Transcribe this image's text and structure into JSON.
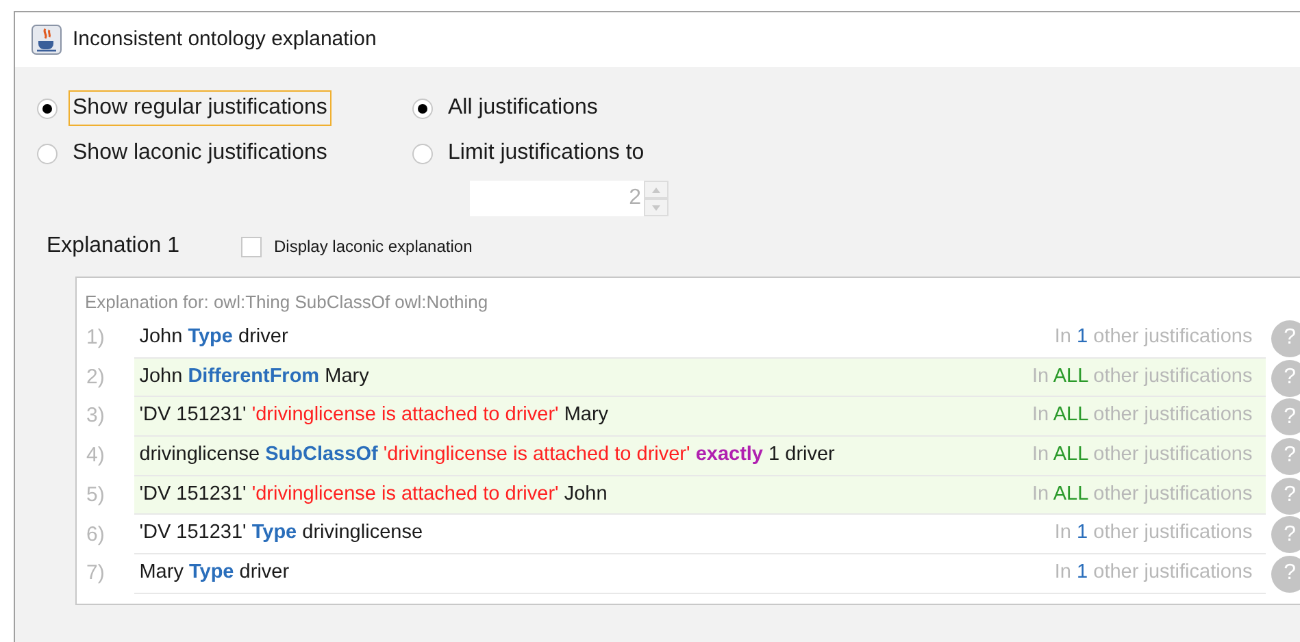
{
  "window": {
    "title": "Inconsistent ontology explanation"
  },
  "mode_options": [
    {
      "label": "Show regular justifications",
      "selected": true,
      "focused": true
    },
    {
      "label": "Show laconic justifications",
      "selected": false,
      "focused": false
    }
  ],
  "limit_options": [
    {
      "label": "All justifications",
      "selected": true
    },
    {
      "label": "Limit justifications to",
      "selected": false
    }
  ],
  "limit_spinner": {
    "value": "2",
    "disabled": true
  },
  "explanation": {
    "title": "Explanation 1",
    "laconic_checkbox": {
      "label": "Display laconic explanation",
      "checked": false
    },
    "header": "Explanation for: owl:Thing SubClassOf owl:Nothing",
    "rows": [
      {
        "number": "1)",
        "highlighted": false,
        "tokens": [
          {
            "text": "John",
            "kind": "plain"
          },
          {
            "text": "Type",
            "kind": "keyword"
          },
          {
            "text": "driver",
            "kind": "plain"
          }
        ],
        "usage": [
          "In",
          "1",
          "other justifications"
        ]
      },
      {
        "number": "2)",
        "highlighted": true,
        "tokens": [
          {
            "text": "John",
            "kind": "plain"
          },
          {
            "text": "DifferentFrom",
            "kind": "keyword"
          },
          {
            "text": "Mary",
            "kind": "plain"
          }
        ],
        "usage": [
          "In",
          "ALL",
          "other justifications"
        ]
      },
      {
        "number": "3)",
        "highlighted": true,
        "tokens": [
          {
            "text": "'DV 151231'",
            "kind": "plain"
          },
          {
            "text": "'drivinglicense is attached to driver'",
            "kind": "property"
          },
          {
            "text": "Mary",
            "kind": "plain"
          }
        ],
        "usage": [
          "In",
          "ALL",
          "other justifications"
        ]
      },
      {
        "number": "4)",
        "highlighted": true,
        "tokens": [
          {
            "text": "drivinglicense",
            "kind": "plain"
          },
          {
            "text": "SubClassOf",
            "kind": "keyword"
          },
          {
            "text": "'drivinglicense is attached to driver'",
            "kind": "property"
          },
          {
            "text": "exactly",
            "kind": "restriction"
          },
          {
            "text": "1 driver",
            "kind": "plain"
          }
        ],
        "usage": [
          "In",
          "ALL",
          "other justifications"
        ]
      },
      {
        "number": "5)",
        "highlighted": true,
        "tokens": [
          {
            "text": "'DV 151231'",
            "kind": "plain"
          },
          {
            "text": "'drivinglicense is attached to driver'",
            "kind": "property"
          },
          {
            "text": "John",
            "kind": "plain"
          }
        ],
        "usage": [
          "In",
          "ALL",
          "other justifications"
        ]
      },
      {
        "number": "6)",
        "highlighted": false,
        "tokens": [
          {
            "text": "'DV 151231'",
            "kind": "plain"
          },
          {
            "text": "Type",
            "kind": "keyword"
          },
          {
            "text": "drivinglicense",
            "kind": "plain"
          }
        ],
        "usage": [
          "In",
          "1",
          "other justifications"
        ]
      },
      {
        "number": "7)",
        "highlighted": false,
        "tokens": [
          {
            "text": "Mary",
            "kind": "plain"
          },
          {
            "text": "Type",
            "kind": "keyword"
          },
          {
            "text": "driver",
            "kind": "plain"
          }
        ],
        "usage": [
          "In",
          "1",
          "other justifications"
        ]
      }
    ],
    "help_label": "?"
  }
}
